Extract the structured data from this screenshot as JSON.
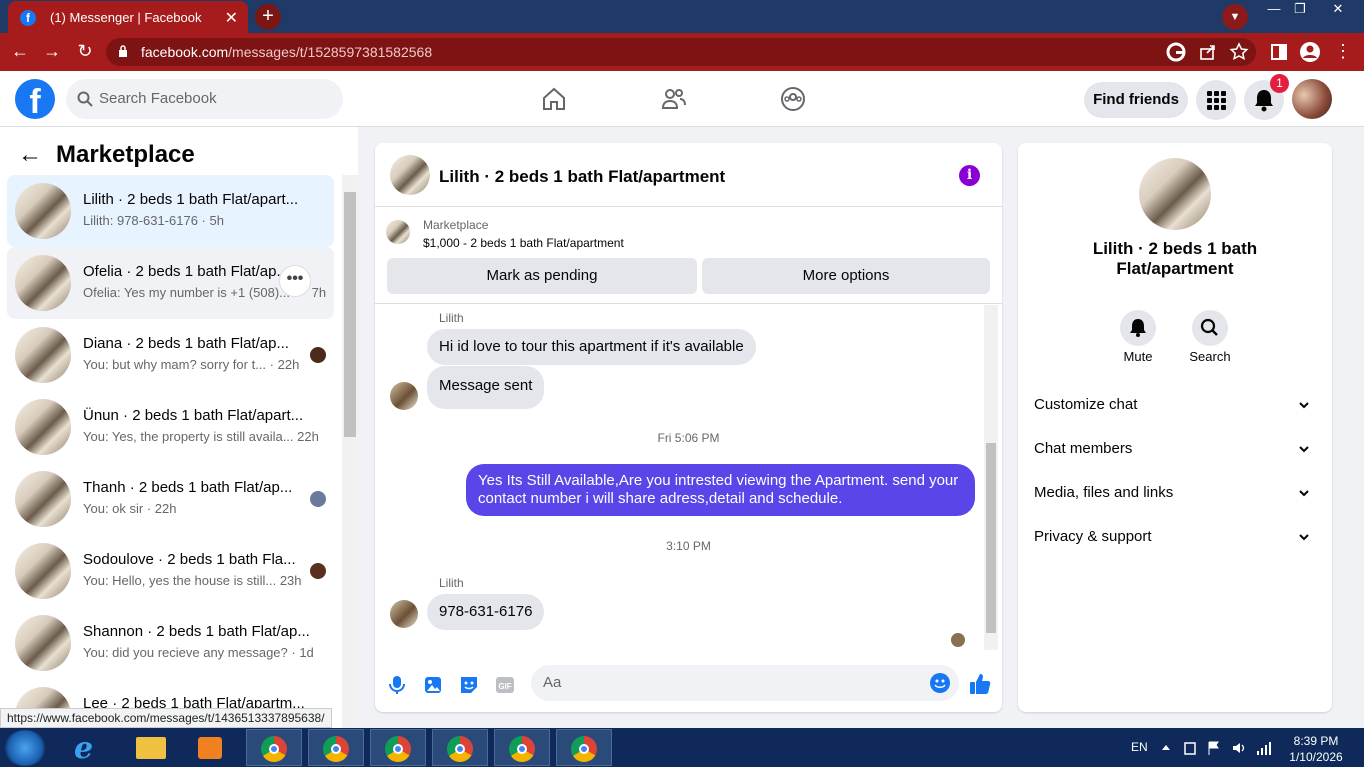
{
  "browser": {
    "tab_title": "(1) Messenger | Facebook",
    "url_host": "facebook.com",
    "url_path": "/messages/t/1528597381582568",
    "status_url": "https://www.facebook.com/messages/t/1436513337895638/"
  },
  "header": {
    "search_placeholder": "Search Facebook",
    "find_friends": "Find friends",
    "notification_count": "1"
  },
  "sidebar": {
    "title": "Marketplace",
    "conversations": [
      {
        "name": "Lilith · 2 beds 1 bath Flat/apart...",
        "preview": "Lilith: 978-631-6176 · 5h"
      },
      {
        "name": "Ofelia · 2 beds 1 bath Flat/ap...",
        "preview": "Ofelia: Yes my number is +1 (508)...",
        "time": "7h"
      },
      {
        "name": "Diana · 2 beds 1 bath Flat/ap...",
        "preview": "You: but why mam? sorry for t...",
        "time": "· 22h"
      },
      {
        "name": "Ünun · 2 beds 1 bath Flat/apart...",
        "preview": "You: Yes, the property is still availa...",
        "time": "22h"
      },
      {
        "name": "Thanh · 2 beds 1 bath Flat/ap...",
        "preview": "You: ok sir · 22h"
      },
      {
        "name": "Sodoulove · 2 beds 1 bath Fla...",
        "preview": "You: Hello, yes the house is still...",
        "time": "23h"
      },
      {
        "name": "Shannon · 2 beds 1 bath Flat/ap...",
        "preview": "You: did you recieve any message? · 1d"
      },
      {
        "name": "Lee · 2 beds 1 bath Flat/apartm...",
        "preview": ""
      }
    ]
  },
  "chat": {
    "title": "Lilith · 2 beds 1 bath Flat/apartment",
    "marketplace_label": "Marketplace",
    "listing": "$1,000 - 2 beds 1 bath Flat/apartment",
    "mark_pending": "Mark as pending",
    "more_options": "More options",
    "sender1": "Lilith",
    "msg1": "Hi id love to tour this apartment if it's available",
    "msg2": "Message sent",
    "time1": "Fri 5:06 PM",
    "msg3": "Yes Its Still Available,Are you intrested viewing the Apartment. send your contact number i will share adress,detail and schedule.",
    "time2": "3:10 PM",
    "sender2": "Lilith",
    "msg4": "978-631-6176",
    "input_placeholder": "Aa"
  },
  "info_panel": {
    "name": "Lilith · 2 beds 1 bath Flat/apartment",
    "mute": "Mute",
    "search": "Search",
    "rows": [
      "Customize chat",
      "Chat members",
      "Media, files and links",
      "Privacy & support"
    ]
  },
  "taskbar": {
    "lang": "EN",
    "time": "8:39 PM",
    "date": "1/10/2026"
  },
  "colors": {
    "browser_red": "#a61b1b",
    "fb_blue": "#1877f2",
    "outgoing_bubble": "#5a45e8",
    "info_purple": "#8a00d4"
  }
}
